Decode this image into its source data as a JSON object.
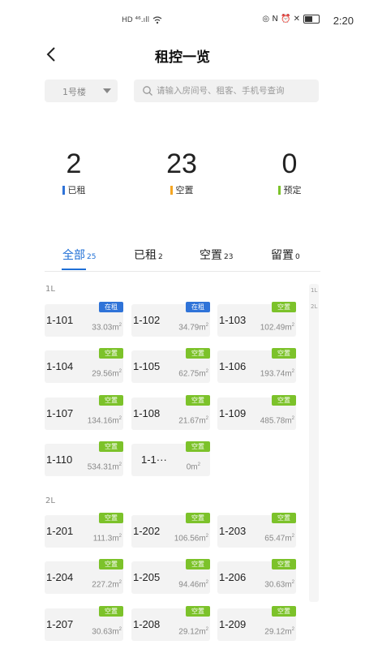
{
  "status_bar": {
    "left_icons": "HD ⁴⁶.ıll ",
    "right_icons": "◎ N ⏰ ✕",
    "time": "2:20"
  },
  "header": {
    "title": "租控一览"
  },
  "filters": {
    "building": "1号楼",
    "search_placeholder": "请输入房间号、租客、手机号查询"
  },
  "stats": [
    {
      "value": "2",
      "label": "已租",
      "color": "#2f73d8"
    },
    {
      "value": "23",
      "label": "空置",
      "color": "#f5a623"
    },
    {
      "value": "0",
      "label": "预定",
      "color": "#7cc22a"
    }
  ],
  "tabs": [
    {
      "label": "全部",
      "count": "25"
    },
    {
      "label": "已租",
      "count": "2"
    },
    {
      "label": "空置",
      "count": "23"
    },
    {
      "label": "留置",
      "count": "0"
    }
  ],
  "side_index": [
    "1L",
    "2L"
  ],
  "floors": [
    {
      "label": "1L",
      "rooms": [
        {
          "no": "1-101",
          "area": "33.03m",
          "status": "在租"
        },
        {
          "no": "1-102",
          "area": "34.79m",
          "status": "在租"
        },
        {
          "no": "1-103",
          "area": "102.49m",
          "status": "空置"
        },
        {
          "no": "1-104",
          "area": "29.56m",
          "status": "空置"
        },
        {
          "no": "1-105",
          "area": "62.75m",
          "status": "空置"
        },
        {
          "no": "1-106",
          "area": "193.74m",
          "status": "空置"
        },
        {
          "no": "1-107",
          "area": "134.16m",
          "status": "空置"
        },
        {
          "no": "1-108",
          "area": "21.67m",
          "status": "空置"
        },
        {
          "no": "1-109",
          "area": "485.78m",
          "status": "空置"
        },
        {
          "no": "1-110",
          "area": "534.31m",
          "status": "空置"
        },
        {
          "no": "1-1···",
          "area": "0m",
          "status": "空置"
        }
      ]
    },
    {
      "label": "2L",
      "rooms": [
        {
          "no": "1-201",
          "area": "111.3m",
          "status": "空置"
        },
        {
          "no": "1-202",
          "area": "106.56m",
          "status": "空置"
        },
        {
          "no": "1-203",
          "area": "65.47m",
          "status": "空置"
        },
        {
          "no": "1-204",
          "area": "227.2m",
          "status": "空置"
        },
        {
          "no": "1-205",
          "area": "94.46m",
          "status": "空置"
        },
        {
          "no": "1-206",
          "area": "30.63m",
          "status": "空置"
        },
        {
          "no": "1-207",
          "area": "30.63m",
          "status": "空置"
        },
        {
          "no": "1-208",
          "area": "29.12m",
          "status": "空置"
        },
        {
          "no": "1-209",
          "area": "29.12m",
          "status": "空置"
        }
      ]
    }
  ],
  "area_unit_superscript": "2",
  "colors": {
    "accent": "#1f6fd6",
    "rented_badge": "#2f73d8",
    "vacant_badge": "#7cc22a"
  }
}
